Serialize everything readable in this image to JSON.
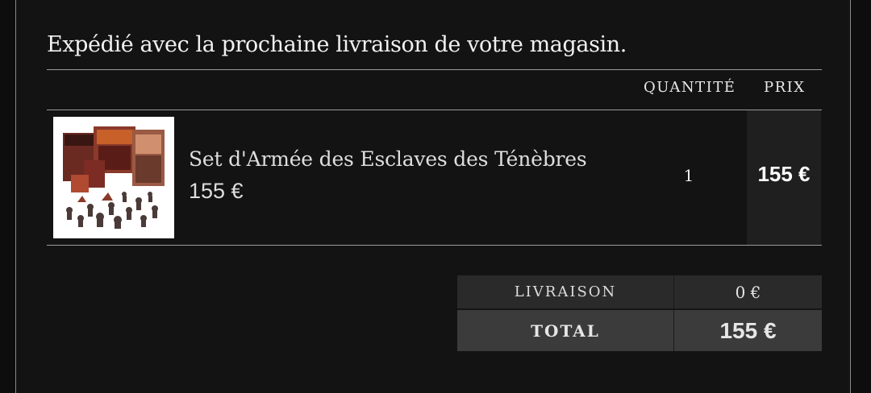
{
  "shipping_note": "Expédié avec la prochaine livraison de votre magasin.",
  "cart": {
    "columns": {
      "quantity": "QUANTITÉ",
      "price": "PRIX"
    },
    "items": [
      {
        "name": "Set d'Armée des Esclaves des Ténèbres",
        "unit_price": "155 €",
        "quantity": "1",
        "line_total": "155 €",
        "image": "product-box-art"
      }
    ]
  },
  "summary": {
    "shipping_label": "LIVRAISON",
    "shipping_value": "0 €",
    "total_label": "TOTAL",
    "total_value": "155 €"
  }
}
